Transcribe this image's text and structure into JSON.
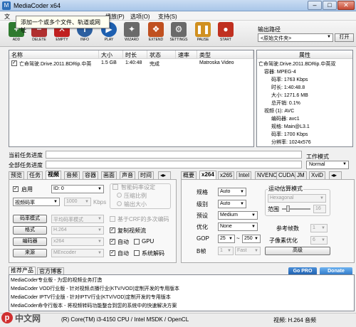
{
  "window": {
    "title": "MediaCoder x64",
    "icon": "mediacoder-icon",
    "controls": [
      "minimize-icon",
      "maximize-icon",
      "close-icon"
    ]
  },
  "menu": {
    "items": [
      "文",
      "播放(P)",
      "选项(O)",
      "支持(S)"
    ]
  },
  "tooltip": {
    "text": "添加一个或多个文件、轨道或网址"
  },
  "toolbar": {
    "buttons": [
      {
        "label": "ADD",
        "icon": "add-icon",
        "color": "#2f7a2f"
      },
      {
        "label": "DELETE",
        "icon": "delete-icon",
        "color": "#b03030"
      },
      {
        "label": "EMPTY",
        "icon": "empty-icon",
        "color": "#c02020"
      },
      {
        "label": "INFO",
        "icon": "info-icon",
        "color": "#2c5fa0"
      },
      {
        "label": "PLAY",
        "icon": "play-icon",
        "color": "#1d5fb0"
      },
      {
        "label": "WIZARD",
        "icon": "wizard-icon",
        "color": "#6a6a6a"
      },
      {
        "label": "EXTEND",
        "icon": "extend-icon",
        "color": "#c05020"
      },
      {
        "label": "SETTINGS",
        "icon": "settings-icon",
        "color": "#6a6a6a"
      },
      {
        "label": "PAUSE",
        "icon": "pause-icon",
        "color": "#d09020"
      },
      {
        "label": "START",
        "icon": "start-icon",
        "color": "#c03020"
      }
    ]
  },
  "output": {
    "label": "输出路径",
    "value": "<原始文件夹>",
    "open_label": "打开"
  },
  "filelist": {
    "columns": [
      "名称",
      "大小",
      "时长",
      "状态",
      "速率",
      "类型"
    ],
    "rows": [
      {
        "checked": true,
        "name": "亡命驾驶.Drive.2011.BDRip.中英",
        "size": "1.5 GB",
        "duration": "1:40:48",
        "status": "完成",
        "rate": "",
        "type": "Matroska Video"
      }
    ]
  },
  "properties": {
    "header": "属性",
    "lines": [
      "亡命驾驶.Drive.2011.BDRip.中英双",
      "容器: MPEG-4",
      "码率: 1763 Kbps",
      "时长: 1:40:48.8",
      "大小: 1271.6 MB",
      "总开销: 0.1%",
      "视频 (1): AVC",
      "编码器: avc1",
      "规格: Main@L3.1",
      "码率: 1700 Kbps",
      "分辨率: 1024x576"
    ]
  },
  "progress": {
    "current_label": "当前任务进度",
    "overall_label": "全部任务进度"
  },
  "workmode": {
    "label": "工作模式",
    "value": "Normal"
  },
  "left_tabs": [
    "预览",
    "任务",
    "视频",
    "音频",
    "容器",
    "画面",
    "声音",
    "时间"
  ],
  "left_tab_selected": "视频",
  "video": {
    "enable_label": "启用",
    "enabled": true,
    "source_id": "ID: 0",
    "bitrate_mode": "视频码率",
    "bitrate": "1000",
    "bitrate_unit": "Kbps",
    "smart_label": "智能码率设定",
    "compress_label": "压缩比例",
    "quality_label": "输出大小",
    "rate_mode_btn": "码率模式",
    "rate_mode_value": "平均码率模式",
    "crf_label": "基于CRF的多次编码",
    "format_btn": "格式",
    "format_value": "H.264",
    "copy_label": "复制视频流",
    "copy_checked": true,
    "encoder_btn": "编码器",
    "encoder_value": "x264",
    "auto1_label": "自动",
    "auto1_checked": true,
    "gpu_label": "GPU",
    "source_btn": "来源",
    "source_value": "MEncoder",
    "auto2_label": "自动",
    "auto2_checked": true,
    "sysdecode_label": "系统解码"
  },
  "right_tabs": [
    "概要",
    "x264",
    "x265",
    "Intel",
    "NVENC",
    "CUDA",
    "JM",
    "XviD"
  ],
  "right_tab_selected": "x264",
  "x264": {
    "profile_label": "规格",
    "profile_value": "Auto",
    "level_label": "级别",
    "level_value": "Auto",
    "preset_label": "预设",
    "preset_value": "Medium",
    "tune_label": "优化",
    "tune_value": "None",
    "gop_label": "GOP",
    "gop_min": "25",
    "gop_tilde": "~",
    "gop_max": "250",
    "bframes_label": "B帧",
    "bframes_value": "1",
    "bframes_fast": "Fast",
    "motion_label": "运动估算模式",
    "motion_value": "Hexagonal",
    "range_label": "范围",
    "range_value": "16",
    "ref_label": "参考帧数",
    "ref_value": "1",
    "subpel_label": "子像素优化",
    "subpel_value": "6",
    "advanced_btn": "高级"
  },
  "news": {
    "tabs": [
      "推荐产品",
      "官方博客"
    ],
    "items": [
      "MediaCoder专业版 - 为您的视频业务打造",
      "MediaCoder VOD行业版 - 针对视频点播行业(KTV/VOD)定制开发的专用版本",
      "MediaCoder IPTV行业版 - 针对IPTV行业(KTV/VOD)定制开发的专用版本",
      "MediaCoder命令行版本 - 将视频转码功能整合到您的系统中的快速解决方案"
    ],
    "gopro": "Go PRO",
    "donate": "Donate"
  },
  "status": {
    "cpu": "(R) Core(TM) i3-4150 CPU / Intel MSDK / OpenCL",
    "video": "视频: H.264  音频"
  },
  "watermark": {
    "text": "php 中文网"
  }
}
